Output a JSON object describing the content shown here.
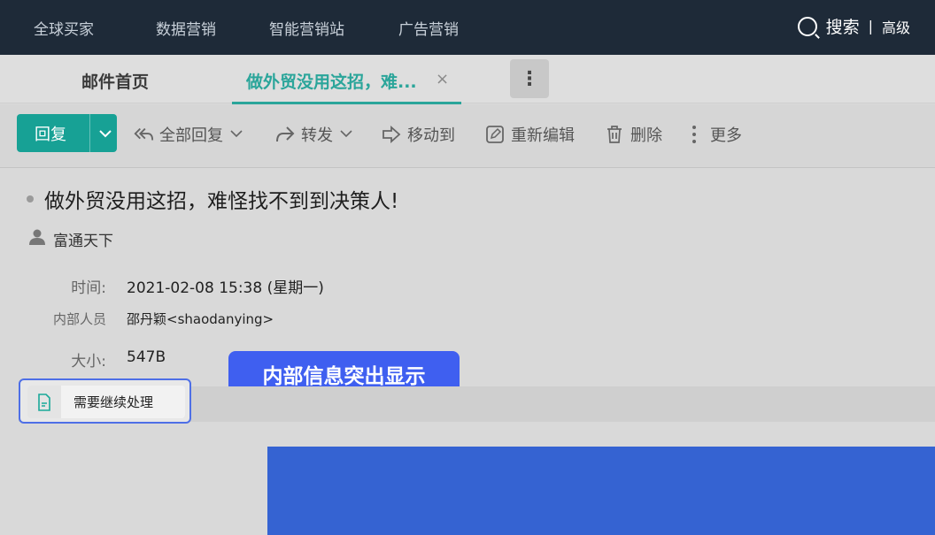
{
  "topnav": {
    "items": [
      "全球买家",
      "数据营销",
      "智能营销站",
      "广告营销"
    ],
    "search_label": "搜索",
    "divider": "|",
    "advanced_label": "高级"
  },
  "tabs": {
    "home_label": "邮件首页",
    "active_label": "做外贸没用这招，难...",
    "close_symbol": "×",
    "more_symbol": "⋮"
  },
  "toolbar": {
    "reply_label": "回复",
    "reply_all_label": "全部回复",
    "forward_label": "转发",
    "move_label": "移动到",
    "reedit_label": "重新编辑",
    "delete_label": "删除",
    "more_label": "更多"
  },
  "mail": {
    "subject": "做外贸没用这招，难怪找不到到决策人!",
    "sender": "富通天下",
    "time_label": "时间:",
    "time_value": "2021-02-08 15:38 (星期一)",
    "internal_label": "内部人员",
    "internal_value": "邵丹颖<shaodanying>",
    "size_label": "大小:",
    "size_value": "547B"
  },
  "callout": {
    "text": "内部信息突出显示"
  },
  "attachment": {
    "name": "需要继续处理"
  },
  "colors": {
    "nav_bg": "#1e2a38",
    "accent_teal": "#17a195",
    "callout_blue": "#3f5ff0",
    "block_blue": "#3563d2"
  }
}
